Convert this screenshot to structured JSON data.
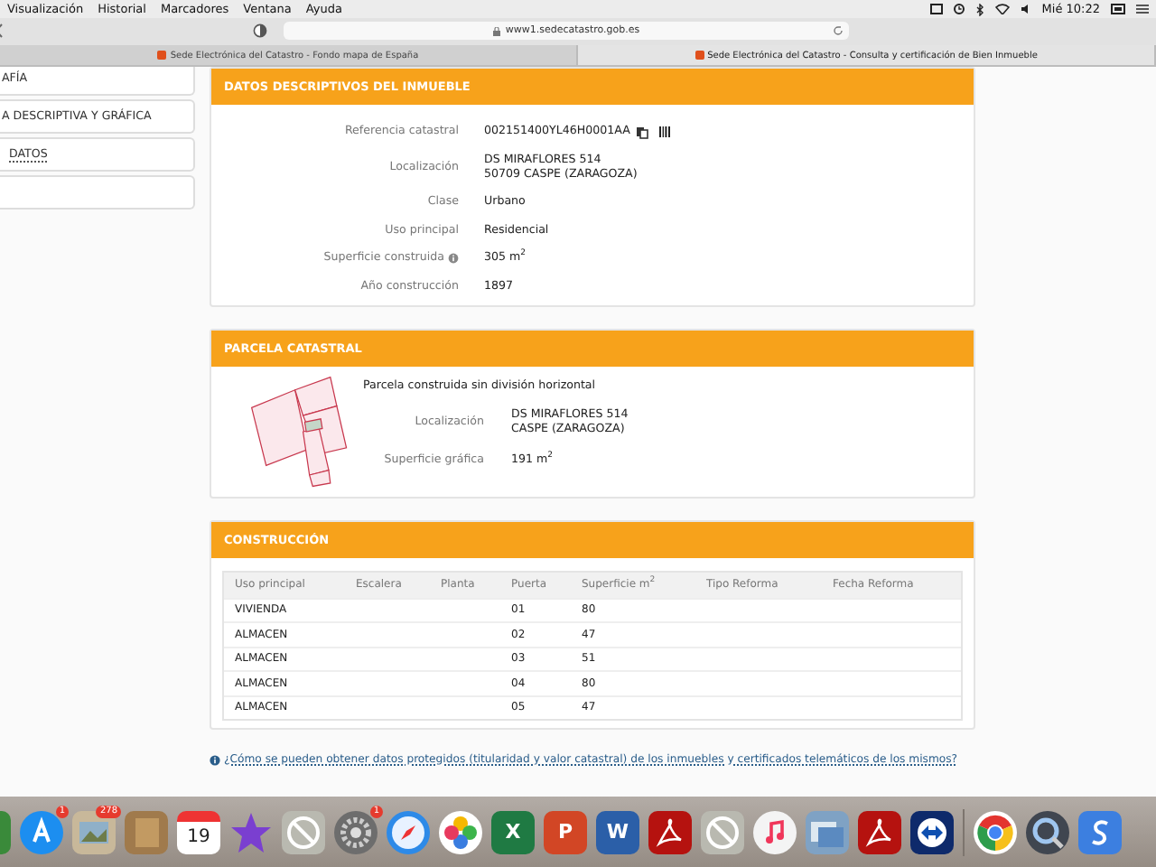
{
  "menu_bar": {
    "items": [
      "Visualización",
      "Historial",
      "Marcadores",
      "Ventana",
      "Ayuda"
    ],
    "clock": "Mié 10:22"
  },
  "toolbar": {
    "url": "www1.sedecatastro.gob.es"
  },
  "tabs": [
    {
      "label": "Sede Electrónica del Catastro - Fondo mapa de España",
      "selected": false
    },
    {
      "label": "Sede Electrónica del Catastro - Consulta y certificación de Bien Inmueble",
      "selected": true
    }
  ],
  "sidebar": {
    "items": [
      {
        "label": "AFÍA",
        "underlined": false
      },
      {
        "label": "A DESCRIPTIVA Y GRÁFICA",
        "underlined": false
      },
      {
        "label": "DATOS",
        "underlined": true
      },
      {
        "underlined": false
      }
    ]
  },
  "descriptive": {
    "title": "DATOS DESCRIPTIVOS DEL INMUEBLE",
    "fields": [
      {
        "label": "Referencia catastral",
        "lines": [
          "002151400YL46H0001AA"
        ],
        "kind": "reference"
      },
      {
        "label": "Localización",
        "lines": [
          "DS MIRAFLORES 514",
          "50709 CASPE (ZARAGOZA)"
        ],
        "kind": "plain"
      },
      {
        "label": "Clase",
        "lines": [
          "Urbano"
        ],
        "kind": "plain"
      },
      {
        "label": "Uso principal",
        "lines": [
          "Residencial"
        ],
        "kind": "plain"
      },
      {
        "label": "Superficie construida",
        "lines": [
          "305 m$^{2}$"
        ],
        "kind": "info"
      },
      {
        "label": "Año construcción",
        "lines": [
          "1897"
        ],
        "kind": "plain"
      }
    ]
  },
  "parcel": {
    "title": "PARCELA CATASTRAL",
    "caption": "Parcela construida sin división horizontal",
    "fields": [
      {
        "label": "Localización",
        "lines": [
          "DS MIRAFLORES 514",
          "CASPE (ZARAGOZA)"
        ]
      },
      {
        "label": "Superficie gráfica",
        "lines": [
          "191 m$^{2}$"
        ]
      }
    ]
  },
  "construction": {
    "title": "CONSTRUCCIÓN",
    "columns": [
      "Uso principal",
      "Escalera",
      "Planta",
      "Puerta",
      "Superficie m$^{2}$",
      "Tipo Reforma",
      "Fecha Reforma"
    ],
    "rows": [
      [
        "VIVIENDA",
        null,
        null,
        "01",
        "80",
        null,
        null
      ],
      [
        "ALMACEN",
        null,
        null,
        "02",
        "47",
        null,
        null
      ],
      [
        "ALMACEN",
        null,
        null,
        "03",
        "51",
        null,
        null
      ],
      [
        "ALMACEN",
        null,
        null,
        "04",
        "80",
        null,
        null
      ],
      [
        "ALMACEN",
        null,
        null,
        "05",
        "47",
        null,
        null
      ]
    ]
  },
  "help_link": "¿Cómo se pueden obtener datos protegidos (titularidad y valor catastral) de los inmuebles y certificados telemáticos de los mismos?",
  "dock": [
    {
      "kind": "green"
    },
    {
      "kind": "store",
      "badge": "1"
    },
    {
      "kind": "photo-frame",
      "badge": "278"
    },
    {
      "kind": "book"
    },
    {
      "kind": "calendar",
      "glyph": "19"
    },
    {
      "kind": "star"
    },
    {
      "kind": "prohibited"
    },
    {
      "kind": "gear",
      "badge": "1"
    },
    {
      "kind": "compass"
    },
    {
      "kind": "flower"
    },
    {
      "kind": "sheet",
      "glyph": "X"
    },
    {
      "kind": "slides",
      "glyph": "P"
    },
    {
      "kind": "doc",
      "glyph": "W"
    },
    {
      "kind": "pdf"
    },
    {
      "kind": "prohibited"
    },
    {
      "kind": "note"
    },
    {
      "kind": "photos"
    },
    {
      "kind": "pdf"
    },
    {
      "kind": "arrows"
    },
    {
      "kind": "separator"
    },
    {
      "kind": "tricolor"
    },
    {
      "kind": "magnifier"
    },
    {
      "kind": "blue"
    }
  ]
}
